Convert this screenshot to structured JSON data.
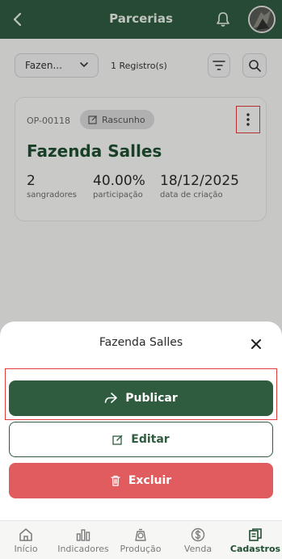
{
  "header": {
    "title": "Parcerias"
  },
  "filters": {
    "select_label": "Fazen...",
    "record_count": "1 Registro(s)"
  },
  "card": {
    "code": "OP-00118",
    "badge": "Rascunho",
    "title": "Fazenda Salles",
    "stats": [
      {
        "value": "2",
        "label": "sangradores"
      },
      {
        "value": "40.00%",
        "label": "participação"
      },
      {
        "value": "18/12/2025",
        "label": "data de criação"
      }
    ]
  },
  "sheet": {
    "title": "Fazenda Salles",
    "actions": {
      "publish": "Publicar",
      "edit": "Editar",
      "delete": "Excluir"
    }
  },
  "nav": {
    "items": [
      {
        "label": "Início",
        "icon": "home-icon"
      },
      {
        "label": "Indicadores",
        "icon": "bar-chart-icon"
      },
      {
        "label": "Produção",
        "icon": "scale-icon"
      },
      {
        "label": "Venda",
        "icon": "dollar-icon"
      },
      {
        "label": "Cadastros",
        "icon": "documents-icon",
        "active": true
      }
    ]
  },
  "colors": {
    "primary": "#2f5b3f",
    "danger": "#e05c5f",
    "highlight": "#e03a3a"
  }
}
